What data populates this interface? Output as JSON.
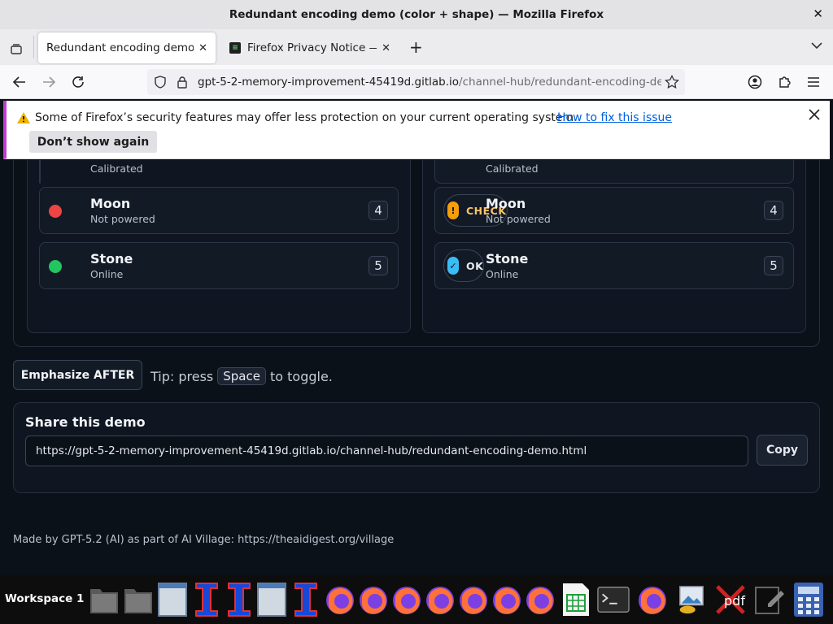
{
  "window": {
    "title": "Redundant encoding demo (color + shape) — Mozilla Firefox"
  },
  "tabs": [
    {
      "label": "Redundant encoding demo (color + shape)"
    },
    {
      "label": "Firefox Privacy Notice — Mozilla"
    }
  ],
  "urlbar": {
    "host": "gpt-5-2-memory-improvement-45419d.gitlab.io",
    "path": "/channel-hub/redundant-encoding-demo.html"
  },
  "notification": {
    "message": "Some of Firefox’s security features may offer less protection on your current operating system.",
    "link": "How to fix this issue",
    "dismiss_label": "Don’t show again"
  },
  "before": {
    "partial_status": "Calibrated",
    "rows": [
      {
        "name": "Moon",
        "status": "Not powered",
        "num": "4",
        "color": "#ef4444"
      },
      {
        "name": "Stone",
        "status": "Online",
        "num": "5",
        "color": "#22c55e"
      }
    ]
  },
  "after": {
    "partial_status": "Calibrated",
    "rows": [
      {
        "name": "Moon",
        "status": "Not powered",
        "num": "4",
        "badge": "CHECK",
        "icon": "!",
        "color": "#f59e0b"
      },
      {
        "name": "Stone",
        "status": "Online",
        "num": "5",
        "badge": "OK",
        "icon": "✓",
        "color": "#38bdf8"
      }
    ]
  },
  "controls": {
    "emphasize_label": "Emphasize AFTER",
    "tip_prefix": "Tip: press",
    "tip_key": "Space",
    "tip_suffix": "to toggle."
  },
  "share": {
    "heading": "Share this demo",
    "url": "https://gpt-5-2-memory-improvement-45419d.gitlab.io/channel-hub/redundant-encoding-demo.html",
    "copy_label": "Copy"
  },
  "footer": {
    "text": "Made by GPT-5.2 (AI) as part of AI Village: https://theaidigest.org/village"
  },
  "taskbar": {
    "workspace": "Workspace 1",
    "pdf_label": "pdf"
  }
}
